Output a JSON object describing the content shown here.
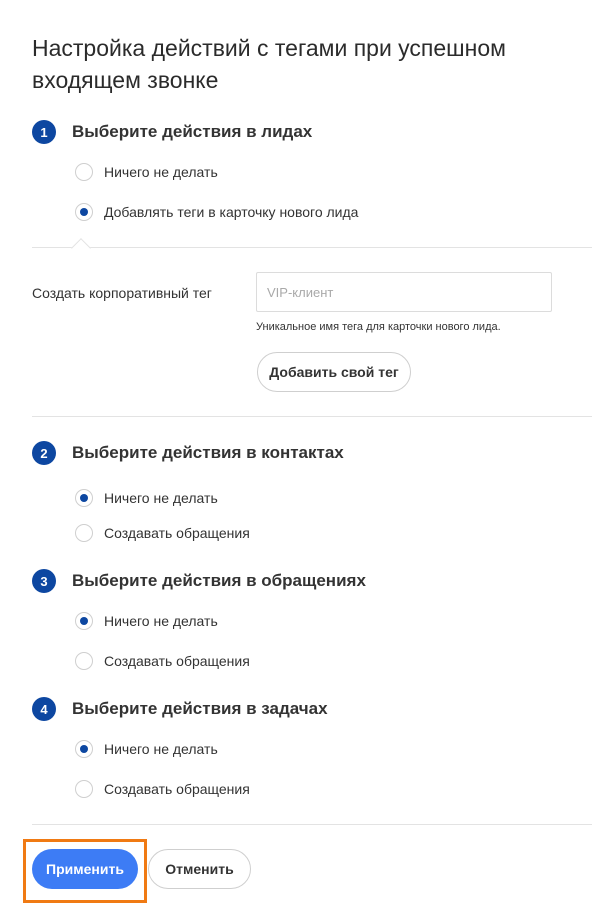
{
  "title": "Настройка действий с тегами при успешном входящем звонке",
  "sections": [
    {
      "number": "1",
      "label": "Выберите действия в лидах",
      "options": [
        {
          "label": "Ничего не делать",
          "checked": false
        },
        {
          "label": "Добавлять теги в карточку нового лида",
          "checked": true
        }
      ]
    },
    {
      "number": "2",
      "label": "Выберите действия в контактах",
      "options": [
        {
          "label": "Ничего не делать",
          "checked": true
        },
        {
          "label": "Создавать обращения",
          "checked": false
        }
      ]
    },
    {
      "number": "3",
      "label": "Выберите действия в обращениях",
      "options": [
        {
          "label": "Ничего не делать",
          "checked": true
        },
        {
          "label": "Создавать обращения",
          "checked": false
        }
      ]
    },
    {
      "number": "4",
      "label": "Выберите действия в задачах",
      "options": [
        {
          "label": "Ничего не делать",
          "checked": true
        },
        {
          "label": "Создавать обращения",
          "checked": false
        }
      ]
    }
  ],
  "tag_form": {
    "label": "Создать корпоративный тег",
    "value": "",
    "placeholder": "VIP-клиент",
    "hint": "Уникальное имя тега для карточки нового лида.",
    "add_button": "Добавить свой тег"
  },
  "footer": {
    "apply_label": "Применить",
    "cancel_label": "Отменить"
  },
  "colors": {
    "accent": "#0d47a1",
    "primary_button": "#3d7cf5",
    "highlight": "#f07a13"
  }
}
